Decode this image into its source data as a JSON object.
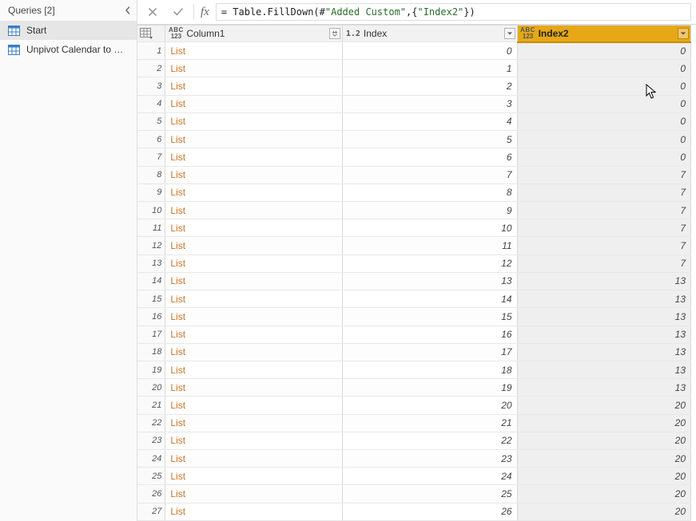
{
  "sidebar": {
    "title": "Queries [2]",
    "items": [
      {
        "label": "Start",
        "selected": true
      },
      {
        "label": "Unpivot Calendar to T…",
        "selected": false
      }
    ]
  },
  "formula": {
    "prefix": "= Table.FillDown(#",
    "arg1": "\"Added Custom\"",
    "mid": ",{",
    "arg2": "\"Index2\"",
    "suffix": "})"
  },
  "columns": {
    "rownum_icon": "table-icon",
    "col1": {
      "type_top": "ABC",
      "type_bot": "123",
      "label": "Column1"
    },
    "index": {
      "type": "1.2",
      "label": "Index"
    },
    "index2": {
      "type_top": "ABC",
      "type_bot": "123",
      "label": "Index2"
    }
  },
  "rows": [
    {
      "n": 1,
      "c1": "List",
      "idx": 0,
      "idx2": 0
    },
    {
      "n": 2,
      "c1": "List",
      "idx": 1,
      "idx2": 0
    },
    {
      "n": 3,
      "c1": "List",
      "idx": 2,
      "idx2": 0
    },
    {
      "n": 4,
      "c1": "List",
      "idx": 3,
      "idx2": 0
    },
    {
      "n": 5,
      "c1": "List",
      "idx": 4,
      "idx2": 0
    },
    {
      "n": 6,
      "c1": "List",
      "idx": 5,
      "idx2": 0
    },
    {
      "n": 7,
      "c1": "List",
      "idx": 6,
      "idx2": 0
    },
    {
      "n": 8,
      "c1": "List",
      "idx": 7,
      "idx2": 7
    },
    {
      "n": 9,
      "c1": "List",
      "idx": 8,
      "idx2": 7
    },
    {
      "n": 10,
      "c1": "List",
      "idx": 9,
      "idx2": 7
    },
    {
      "n": 11,
      "c1": "List",
      "idx": 10,
      "idx2": 7
    },
    {
      "n": 12,
      "c1": "List",
      "idx": 11,
      "idx2": 7
    },
    {
      "n": 13,
      "c1": "List",
      "idx": 12,
      "idx2": 7
    },
    {
      "n": 14,
      "c1": "List",
      "idx": 13,
      "idx2": 13
    },
    {
      "n": 15,
      "c1": "List",
      "idx": 14,
      "idx2": 13
    },
    {
      "n": 16,
      "c1": "List",
      "idx": 15,
      "idx2": 13
    },
    {
      "n": 17,
      "c1": "List",
      "idx": 16,
      "idx2": 13
    },
    {
      "n": 18,
      "c1": "List",
      "idx": 17,
      "idx2": 13
    },
    {
      "n": 19,
      "c1": "List",
      "idx": 18,
      "idx2": 13
    },
    {
      "n": 20,
      "c1": "List",
      "idx": 19,
      "idx2": 13
    },
    {
      "n": 21,
      "c1": "List",
      "idx": 20,
      "idx2": 20
    },
    {
      "n": 22,
      "c1": "List",
      "idx": 21,
      "idx2": 20
    },
    {
      "n": 23,
      "c1": "List",
      "idx": 22,
      "idx2": 20
    },
    {
      "n": 24,
      "c1": "List",
      "idx": 23,
      "idx2": 20
    },
    {
      "n": 25,
      "c1": "List",
      "idx": 24,
      "idx2": 20
    },
    {
      "n": 26,
      "c1": "List",
      "idx": 25,
      "idx2": 20
    },
    {
      "n": 27,
      "c1": "List",
      "idx": 26,
      "idx2": 20
    }
  ]
}
